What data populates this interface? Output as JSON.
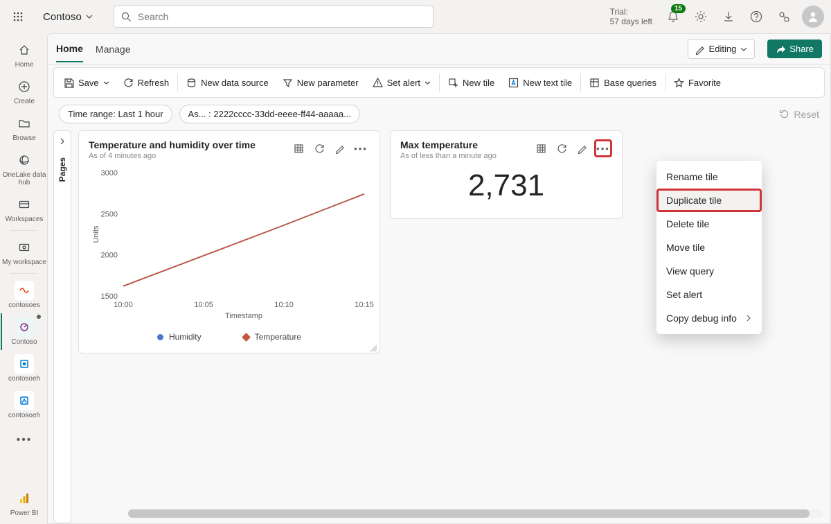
{
  "topbar": {
    "workspace": "Contoso",
    "search_placeholder": "Search",
    "trial_label": "Trial:",
    "trial_days": "57 days left",
    "notif_count": "15"
  },
  "leftnav": {
    "items": [
      {
        "label": "Home"
      },
      {
        "label": "Create"
      },
      {
        "label": "Browse"
      },
      {
        "label": "OneLake data hub"
      },
      {
        "label": "Workspaces"
      },
      {
        "label": "My workspace"
      },
      {
        "label": "contosoes"
      },
      {
        "label": "Contoso"
      },
      {
        "label": "contosoeh"
      },
      {
        "label": "contosoeh"
      }
    ],
    "product": "Power BI"
  },
  "tabs": {
    "home": "Home",
    "manage": "Manage"
  },
  "edit_label": "Editing",
  "share_label": "Share",
  "toolbar": {
    "save": "Save",
    "refresh": "Refresh",
    "new_data_source": "New data source",
    "new_parameter": "New parameter",
    "set_alert": "Set alert",
    "new_tile": "New tile",
    "new_text_tile": "New text tile",
    "base_queries": "Base queries",
    "favorite": "Favorite"
  },
  "pills": {
    "time_range": "Time range: Last 1 hour",
    "param": "As... : 2222cccc-33dd-eeee-ff44-aaaaa...",
    "reset": "Reset"
  },
  "pages_label": "Pages",
  "tiles": {
    "chart": {
      "title": "Temperature and humidity over time",
      "sub": "As of 4 minutes ago",
      "ylabel": "Units",
      "xlabel": "Timestamp",
      "legend_a": "Humidity",
      "legend_b": "Temperature"
    },
    "max": {
      "title": "Max temperature",
      "sub": "As of less than a minute ago",
      "value": "2,731"
    }
  },
  "context_menu": {
    "rename": "Rename tile",
    "duplicate": "Duplicate tile",
    "delete": "Delete tile",
    "move": "Move tile",
    "view_query": "View query",
    "set_alert": "Set alert",
    "copy_debug": "Copy debug info"
  },
  "chart_data": {
    "type": "line",
    "title": "Temperature and humidity over time",
    "xlabel": "Timestamp",
    "ylabel": "Units",
    "categories": [
      "10:00",
      "10:05",
      "10:10",
      "10:15"
    ],
    "ylim": [
      1500,
      3000
    ],
    "yticks": [
      1500,
      2000,
      2500,
      3000
    ],
    "series": [
      {
        "name": "Humidity",
        "values": [
          1620,
          1990,
          2360,
          2740
        ],
        "color": "#4878c9"
      },
      {
        "name": "Temperature",
        "values": [
          1620,
          1990,
          2360,
          2740
        ],
        "color": "#c0593f"
      }
    ]
  }
}
